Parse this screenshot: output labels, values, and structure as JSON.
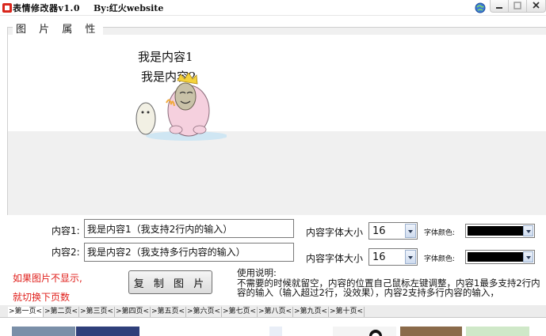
{
  "window": {
    "title": "表情修改器v1.0",
    "author": "By:红火website"
  },
  "picture_group": {
    "label": "图 片 属 性",
    "line1": "我是内容1",
    "line2": "我是内容2"
  },
  "content1": {
    "label": "内容1:",
    "value": "我是内容1（我支持2行内的输入）",
    "size_label": "内容字体大小",
    "size_value": "16",
    "color_label": "字体颜色:",
    "color": "#000000"
  },
  "content2": {
    "label": "内容2:",
    "value": "我是内容2（我支持多行内容的输入）",
    "size_label": "内容字体大小",
    "size_value": "16",
    "color_label": "字体颜色:",
    "color": "#000000"
  },
  "notice": {
    "line1": "如果图片不显示,",
    "line2": "就切换下页数"
  },
  "copy_button": "复 制 图 片",
  "help": {
    "title": "使用说明:",
    "text": "不需要的时候就留空，内容的位置自己鼠标左键调整，内容1最多支持2行内容的输入（输入超过2行，没效果），内容2支持多行内容的输入，"
  },
  "tabs": [
    ">第一页<",
    ">第二页<",
    ">第三页<",
    ">第四页<",
    ">第五页<",
    ">第六页<",
    ">第七页<",
    ">第八页<",
    ">第九页<",
    ">第十页<"
  ],
  "colors": {
    "accent_red": "#e0201c",
    "panel_gray": "#f0f0f0"
  }
}
